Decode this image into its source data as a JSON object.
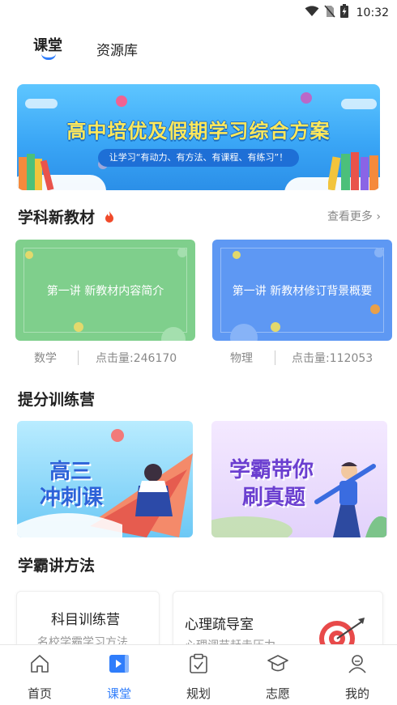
{
  "status_bar": {
    "time": "10:32",
    "icons": [
      "wifi-icon",
      "no-sim-icon",
      "battery-charging-icon"
    ]
  },
  "top_tabs": [
    {
      "label": "课堂",
      "active": true
    },
    {
      "label": "资源库",
      "active": false
    }
  ],
  "banner": {
    "title": "高中培优及假期学习综合方案",
    "subtitle": "让学习“有动力、有方法、有课程、有练习”！"
  },
  "new_textbook": {
    "title": "学科新教材",
    "more_label": "查看更多 ›",
    "cards": [
      {
        "label": "第一讲 新教材内容简介",
        "subject": "数学",
        "clicks": "点击量:246170"
      },
      {
        "label": "第一讲 新教材修订背景概要",
        "subject": "物理",
        "clicks": "点击量:112053"
      }
    ]
  },
  "training_camp": {
    "title": "提分训练营",
    "cards": [
      {
        "line1": "高三",
        "line2": "冲刺课"
      },
      {
        "line1": "学霸带你",
        "line2": "刷真题"
      }
    ]
  },
  "methods": {
    "title": "学霸讲方法",
    "cards": [
      {
        "title": "科目训练营",
        "subtitle": "名校学霸学习方法"
      },
      {
        "title": "心理疏导室",
        "subtitle": "心理调节赶走压力"
      }
    ]
  },
  "bottom_nav": [
    {
      "label": "首页",
      "icon": "home-icon",
      "active": false
    },
    {
      "label": "课堂",
      "icon": "classroom-play-icon",
      "active": true
    },
    {
      "label": "规划",
      "icon": "plan-clipboard-icon",
      "active": false
    },
    {
      "label": "志愿",
      "icon": "graduation-cap-icon",
      "active": false
    },
    {
      "label": "我的",
      "icon": "profile-icon",
      "active": false
    }
  ],
  "colors": {
    "accent": "#2f7dfb",
    "fire": "#f04a2a",
    "green_card": "#7fcf8c",
    "blue_card": "#5e98f3"
  }
}
